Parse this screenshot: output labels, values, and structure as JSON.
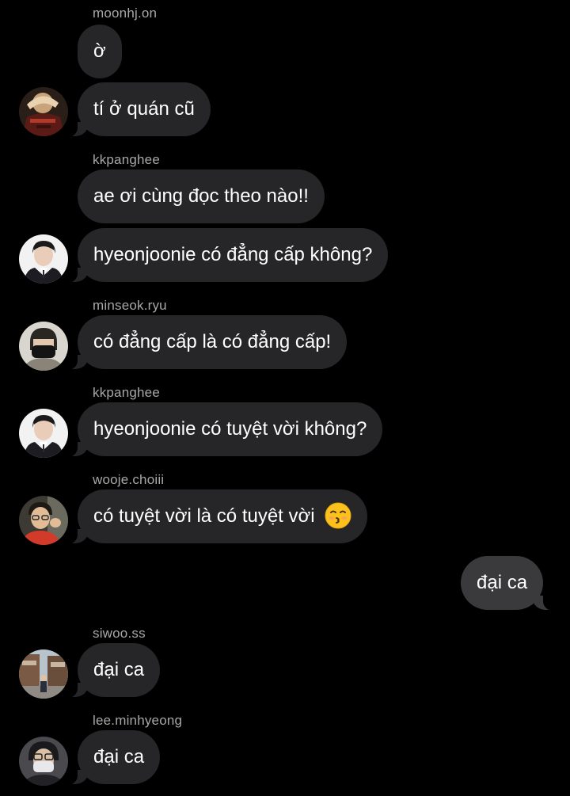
{
  "messages": [
    {
      "sender": "moonhj.on",
      "text": "ờ"
    },
    {
      "text": "tí ở quán cũ"
    },
    {
      "sender": "kkpanghee",
      "text": "ae ơi cùng đọc theo nào!!"
    },
    {
      "text": "hyeonjoonie có đẳng cấp không?"
    },
    {
      "sender": "minseok.ryu",
      "text": "có đẳng cấp là có đẳng cấp!"
    },
    {
      "sender": "kkpanghee",
      "text": "hyeonjoonie có tuyệt vời không?"
    },
    {
      "sender": "wooje.choiii",
      "text": "có tuyệt vời là có tuyệt vời",
      "emoji": "kissing-face-emoji"
    },
    {
      "text": "đại ca",
      "outgoing": true
    },
    {
      "sender": "siwoo.ss",
      "text": "đại ca"
    },
    {
      "sender": "lee.minhyeong",
      "text": "đại ca"
    }
  ],
  "colors": {
    "background": "#000000",
    "incoming_bubble": "#262628",
    "outgoing_bubble": "#3a3a3c",
    "sender_name": "#a8a8a8",
    "message_text": "#ffffff"
  }
}
